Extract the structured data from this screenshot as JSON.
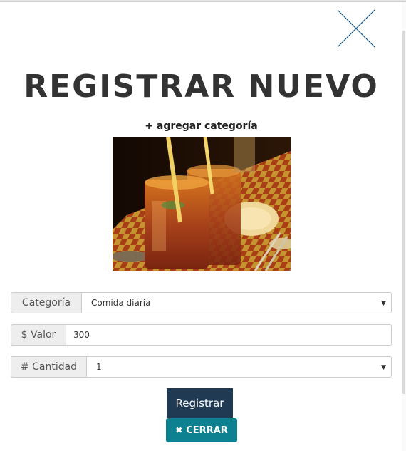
{
  "modal": {
    "title": "REGISTRAR NUEVO",
    "add_category_link": "+ agregar categoría"
  },
  "form": {
    "category": {
      "label": "Categoría",
      "value": "Comida diaria"
    },
    "value": {
      "label": "$ Valor",
      "value": "300"
    },
    "quantity": {
      "label": "# Cantidad",
      "value": "1"
    }
  },
  "buttons": {
    "submit_label": "Registrar",
    "close_label": "CERRAR"
  },
  "icons": {
    "close": "close-x-icon",
    "dropdown": "caret-down-icon",
    "close_small": "times-icon"
  },
  "colors": {
    "submit_bg": "#1f3a52",
    "close_bg": "#0e8191",
    "title": "#333333"
  }
}
